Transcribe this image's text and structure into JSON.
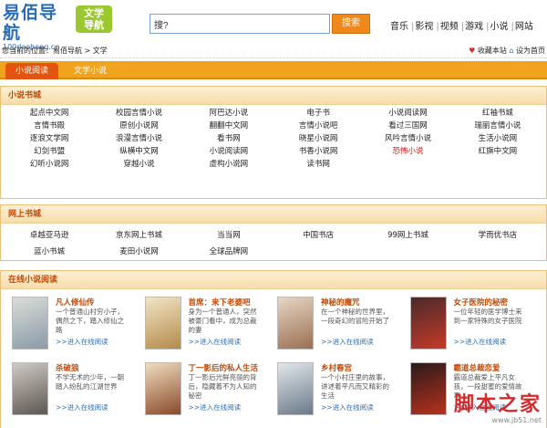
{
  "header": {
    "logo_title": "易佰导航",
    "logo_url": "100daohang.cn",
    "badge": "文学\n导航",
    "search_value": "搜?",
    "search_button": "搜索",
    "nav": [
      "音乐",
      "影视",
      "视频",
      "游戏",
      "小说",
      "网站"
    ]
  },
  "subbar": {
    "breadcrumb": "您当前的位置：易佰导航 > 文学",
    "favorite": "收藏本站",
    "homepage": "设为首页"
  },
  "tabs": [
    "小说阅读",
    "文学小说"
  ],
  "novel_sites": {
    "title": "小说书城",
    "items": [
      "起点中文网",
      "校园言情小说",
      "阿巴达小说",
      "电子书",
      "小说阅读网",
      "红袖书城",
      "言情书殿",
      "原创小说网",
      "翻翻中文网",
      "言情小说吧",
      "看过三国网",
      "瑞丽言情小说",
      "逐浪文学网",
      "浪漫言情小说",
      "看书网",
      "晓星小说网",
      "风吟言情小说",
      "生活小说网",
      "幻剑书盟",
      "纵横中文网",
      "小说阅读网",
      "书香小说网",
      "恐怖小说",
      "红旗中文网",
      "幻听小说网",
      "穿越小说",
      "虚构小说网",
      "读书网",
      "",
      ""
    ],
    "highlight_index": 22
  },
  "online_stores": {
    "title": "网上书城",
    "items": [
      "卓越亚马逊",
      "京东网上书城",
      "当当网",
      "中国书店",
      "99网上书城",
      "学而优书店",
      "蓝小书城",
      "麦田小说网",
      "全球品牌网",
      "",
      "",
      ""
    ]
  },
  "online_reading": {
    "title": "在线小说阅读",
    "books": [
      {
        "title": "凡人修仙传",
        "desc": "一个普通山村穷小子，偶然之下，踏入修仙之路",
        "link": ">>进入在线阅读",
        "cover": [
          "#d9ddd8",
          "#8a9aa8"
        ]
      },
      {
        "title": "首席：来下老婆吧",
        "desc": "身为一个普通人，突然被豪门看中，成为总裁的妻",
        "link": ">>进入在线阅读",
        "cover": [
          "#f1e5c6",
          "#b58a4a"
        ]
      },
      {
        "title": "神秘的魔咒",
        "desc": "在一个神秘的世界里，一段奇幻的冒险开始了",
        "link": ">>进入在线阅读",
        "cover": [
          "#e6d7c4",
          "#9a6f52"
        ]
      },
      {
        "title": "女子医院的秘密",
        "desc": "一位年轻的医学博士来到一家特殊的女子医院",
        "link": ">>进入在线阅读",
        "cover": [
          "#4a2a2a",
          "#c63a2a"
        ]
      },
      {
        "title": "杀破狼",
        "desc": "不学无术的少年，一朝踏入纷乱的江湖世界",
        "link": ">>进入在线阅读",
        "cover": [
          "#cfcac4",
          "#5e5650"
        ]
      },
      {
        "title": "丁一影后的私人生活",
        "desc": "丁一影后光鲜亮丽的背后，隐藏着不为人知的秘密",
        "link": ">>进入在线阅读",
        "cover": [
          "#f0dcc0",
          "#8a4a2a"
        ]
      },
      {
        "title": "乡村春宫",
        "desc": "一个小村庄里的故事，讲述着平凡而又精彩的生活",
        "link": ">>进入在线阅读",
        "cover": [
          "#e2e6ea",
          "#6a7a8a"
        ]
      },
      {
        "title": "霸道总裁恋爱",
        "desc": "霸道总裁爱上平凡女孩，一段甜蜜的爱情故事",
        "link": ">>进入在线阅读",
        "cover": [
          "#2a1a1a",
          "#b8321e"
        ]
      }
    ]
  },
  "watermark": {
    "main": "脚本之家",
    "sub": "www.jb51.net"
  }
}
